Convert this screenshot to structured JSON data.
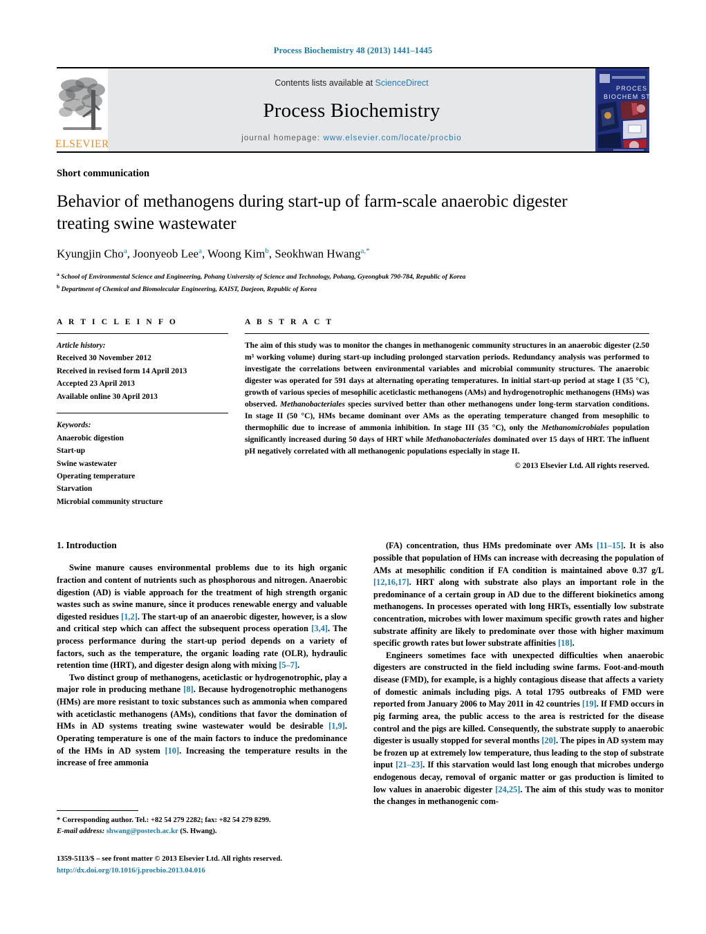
{
  "running_head": "Process Biochemistry 48 (2013) 1441–1445",
  "masthead": {
    "contents_prefix": "Contents lists available at ",
    "sciencedirect": "ScienceDirect",
    "journal_title": "Process Biochemistry",
    "homepage_prefix": "journal homepage: ",
    "homepage_url": "www.elsevier.com/locate/procbio",
    "publisher_logo_text": "ELSEVIER",
    "cover_line1": "PROCESS",
    "cover_line2": "BIOCHEM STRY",
    "link_color": "#2a7ab0",
    "accent_orange": "#ee8a1e"
  },
  "article": {
    "type": "Short communication",
    "title": "Behavior of methanogens during start-up of farm-scale anaerobic digester treating swine wastewater",
    "authors_html": "Kyungjin Cho<sup>a</sup>, Joonyeob Lee<sup>a</sup>, Woong Kim<sup>b</sup>, Seokhwan Hwang<sup>a,</sup><sup>*</sup>",
    "affiliation_a": "School of Environmental Science and Engineering, Pohang University of Science and Technology, Pohang, Gyeongbuk 790-784, Republic of Korea",
    "affiliation_b": "Department of Chemical and Biomolecular Engineering, KAIST, Daejeon, Republic of Korea"
  },
  "article_info": {
    "label": "A R T I C L E    I N F O",
    "history_label": "Article history:",
    "history": [
      "Received 30 November 2012",
      "Received in revised form 14 April 2013",
      "Accepted 23 April 2013",
      "Available online 30 April 2013"
    ],
    "keywords_label": "Keywords:",
    "keywords": [
      "Anaerobic digestion",
      "Start-up",
      "Swine wastewater",
      "Operating temperature",
      "Starvation",
      "Microbial community structure"
    ]
  },
  "abstract": {
    "label": "A B S T R A C T",
    "text": "The aim of this study was to monitor the changes in methanogenic community structures in an anaerobic digester (2.50 m³ working volume) during start-up including prolonged starvation periods. Redundancy analysis was performed to investigate the correlations between environmental variables and microbial community structures. The anaerobic digester was operated for 591 days at alternating operating temperatures. In initial start-up period at stage I (35 °C), growth of various species of mesophilic aceticlastic methanogens (AMs) and hydrogenotrophic methanogens (HMs) was observed. Methanobacteriales species survived better than other methanogens under long-term starvation conditions. In stage II (50 °C), HMs became dominant over AMs as the operating temperature changed from mesophilic to thermophilic due to increase of ammonia inhibition. In stage III (35 °C), only the Methanomicrobiales population significantly increased during 50 days of HRT while Methanobacteriales dominated over 15 days of HRT. The influent pH negatively correlated with all methanogenic populations especially in stage II.",
    "copyright": "© 2013 Elsevier Ltd. All rights reserved."
  },
  "introduction": {
    "heading": "1.  Introduction",
    "left_paragraphs": [
      "Swine manure causes environmental problems due to its high organic fraction and content of nutrients such as phosphorous and nitrogen. Anaerobic digestion (AD) is viable approach for the treatment of high strength organic wastes such as swine manure, since it produces renewable energy and valuable digested residues [1,2]. The start-up of an anaerobic digester, however, is a slow and critical step which can affect the subsequent process operation [3,4]. The process performance during the start-up period depends on a variety of factors, such as the temperature, the organic loading rate (OLR), hydraulic retention time (HRT), and digester design along with mixing [5–7].",
      "Two distinct group of methanogens, aceticlastic or hydrogenotrophic, play a major role in producing methane [8]. Because hydrogenotrophic methanogens (HMs) are more resistant to toxic substances such as ammonia when compared with aceticlastic methanogens (AMs), conditions that favor the domination of HMs in AD systems treating swine wastewater would be desirable [1,9]. Operating temperature is one of the main factors to induce the predominance of the HMs in AD system [10]. Increasing the temperature results in the increase of free ammonia"
    ],
    "right_paragraphs": [
      "(FA) concentration, thus HMs predominate over AMs [11–15]. It is also possible that population of HMs can increase with decreasing the population of AMs at mesophilic condition if FA condition is maintained above 0.37 g/L [12,16,17]. HRT along with substrate also plays an important role in the predominance of a certain group in AD due to the different biokinetics among methanogens. In processes operated with long HRTs, essentially low substrate concentration, microbes with lower maximum specific growth rates and higher substrate affinity are likely to predominate over those with higher maximum specific growth rates but lower substrate affinities [18].",
      "Engineers sometimes face with unexpected difficulties when anaerobic digesters are constructed in the field including swine farms. Foot-and-mouth disease (FMD), for example, is a highly contagious disease that affects a variety of domestic animals including pigs. A total 1795 outbreaks of FMD were reported from January 2006 to May 2011 in 42 countries [19]. If FMD occurs in pig farming area, the public access to the area is restricted for the disease control and the pigs are killed. Consequently, the substrate supply to anaerobic digester is usually stopped for several months [20]. The pipes in AD system may be frozen up at extremely low temperature, thus leading to the stop of substrate input [21–23]. If this starvation would last long enough that microbes undergo endogenous decay, removal of organic matter or gas production is limited to low values in anaerobic digester [24,25]. The aim of this study was to monitor the changes in methanogenic com-"
    ]
  },
  "footnote": {
    "corresponding": "* Corresponding author. Tel.: +82 54 279 2282; fax: +82 54 279 8299.",
    "email_label": "E-mail address:",
    "email": "shwang@postech.ac.kr",
    "email_suffix": "(S. Hwang)."
  },
  "footer": {
    "issn_line": "1359-5113/$ – see front matter © 2013 Elsevier Ltd. All rights reserved.",
    "doi": "http://dx.doi.org/10.1016/j.procbio.2013.04.016"
  }
}
